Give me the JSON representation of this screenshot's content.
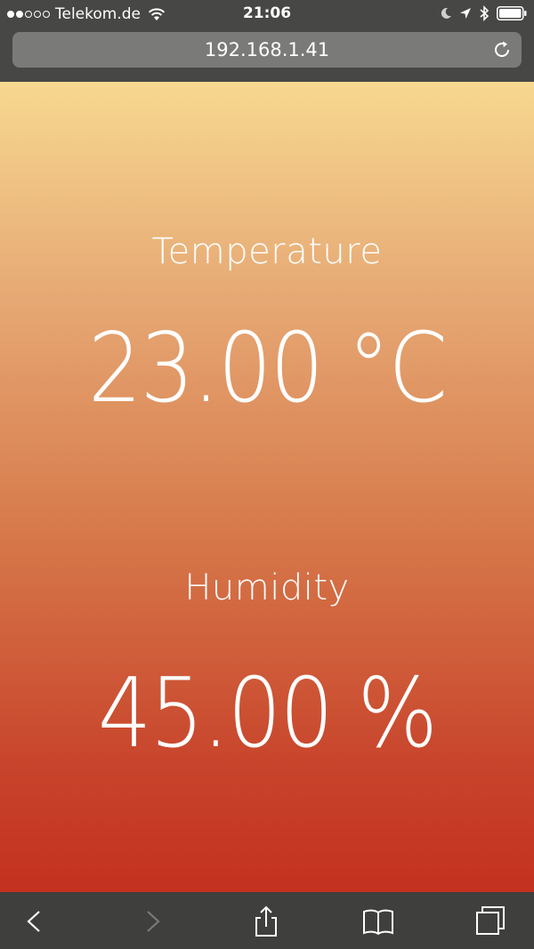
{
  "status_bar": {
    "carrier": "Telekom.de",
    "time": "21:06",
    "signal_bars_filled": 2,
    "signal_bars_total": 5
  },
  "browser": {
    "url": "192.168.1.41"
  },
  "page": {
    "temperature": {
      "label": "Temperature",
      "value": "23.00 °C"
    },
    "humidity": {
      "label": "Humidity",
      "value": "45.00 %"
    }
  },
  "icons": {
    "status": [
      "wifi-icon",
      "moon-icon",
      "location-arrow-icon",
      "bluetooth-icon",
      "battery-icon"
    ],
    "toolbar": [
      "back-icon",
      "forward-icon",
      "share-icon",
      "bookmarks-icon",
      "tabs-icon"
    ]
  },
  "colors": {
    "gradient_top": "#f7d890",
    "gradient_bottom": "#c3311f",
    "chrome": "#474745"
  }
}
